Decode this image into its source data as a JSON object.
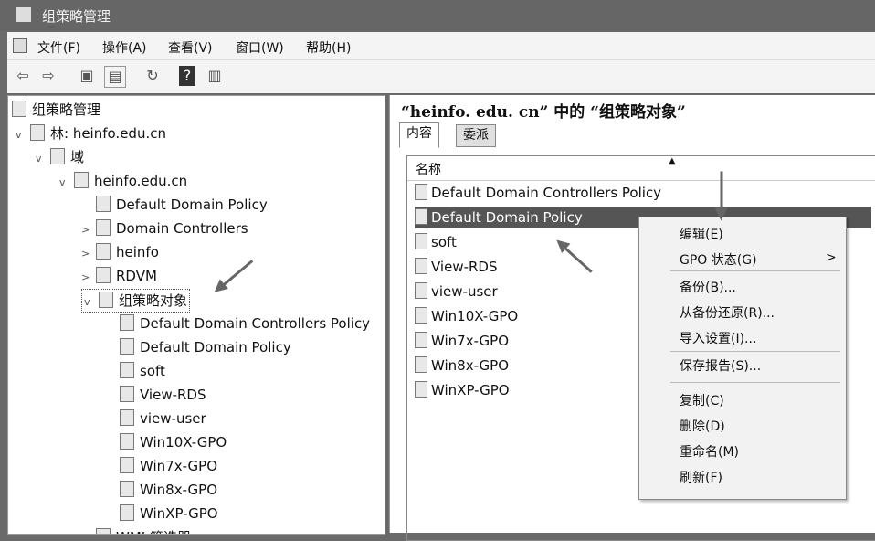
{
  "window": {
    "title": "组策略管理"
  },
  "menu": [
    "文件(F)",
    "操作(A)",
    "查看(V)",
    "窗口(W)",
    "帮助(H)"
  ],
  "toolbar": {
    "help": "?"
  },
  "tree": [
    {
      "label": "组策略管理",
      "level": 0,
      "exp": ""
    },
    {
      "label": "林: heinfo.edu.cn",
      "level": 1,
      "exp": "v"
    },
    {
      "label": "域",
      "level": 2,
      "exp": "v"
    },
    {
      "label": "heinfo.edu.cn",
      "level": 3,
      "exp": "v"
    },
    {
      "label": "Default Domain Policy",
      "level": 4,
      "exp": ""
    },
    {
      "label": "Domain Controllers",
      "level": 4,
      "exp": ">"
    },
    {
      "label": "heinfo",
      "level": 4,
      "exp": ">"
    },
    {
      "label": "RDVM",
      "level": 4,
      "exp": ">"
    },
    {
      "label": "组策略对象",
      "level": 4,
      "exp": "v"
    },
    {
      "label": "Default Domain Controllers Policy",
      "level": 5,
      "exp": ""
    },
    {
      "label": "Default Domain Policy",
      "level": 5,
      "exp": ""
    },
    {
      "label": "soft",
      "level": 5,
      "exp": ""
    },
    {
      "label": "View-RDS",
      "level": 5,
      "exp": ""
    },
    {
      "label": "view-user",
      "level": 5,
      "exp": ""
    },
    {
      "label": "Win10X-GPO",
      "level": 5,
      "exp": ""
    },
    {
      "label": "Win7x-GPO",
      "level": 5,
      "exp": ""
    },
    {
      "label": "Win8x-GPO",
      "level": 5,
      "exp": ""
    },
    {
      "label": "WinXP-GPO",
      "level": 5,
      "exp": ""
    },
    {
      "label": "WMI 筛选器",
      "level": 4,
      "exp": ""
    }
  ],
  "right": {
    "heading": "“heinfo. edu. cn” 中的 “组策略对象”",
    "tabs": [
      "内容",
      "委派"
    ],
    "column": "名称",
    "rows": [
      "Default Domain Controllers Policy",
      "Default Domain Policy",
      "soft",
      "View-RDS",
      "view-user",
      "Win10X-GPO",
      "Win7x-GPO",
      "Win8x-GPO",
      "WinXP-GPO"
    ]
  },
  "context_menu": {
    "items": [
      "编辑(E)",
      "GPO 状态(G)",
      "备份(B)...",
      "从备份还原(R)...",
      "导入设置(I)...",
      "保存报告(S)...",
      "复制(C)",
      "删除(D)",
      "重命名(M)",
      "刷新(F)"
    ],
    "submenu_arrow": ">"
  }
}
